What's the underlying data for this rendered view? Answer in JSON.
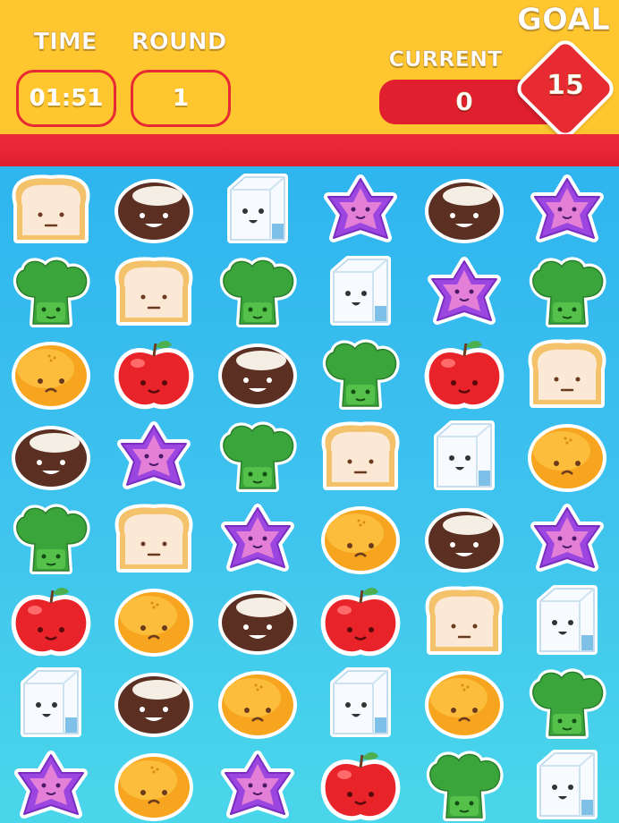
{
  "hud": {
    "time_label": "TIME",
    "time_value": "01:51",
    "round_label": "ROUND",
    "round_value": "1",
    "current_label": "CURRENT",
    "current_value": "0",
    "goal_label": "GOAL",
    "goal_value": "15",
    "progress": 0
  },
  "colors": {
    "header": "#ffc62f",
    "accent_red": "#e82a32",
    "board_top": "#2fb5ef",
    "board_bottom": "#4ad6ea"
  },
  "board": {
    "rows": 8,
    "cols": 6,
    "tiles": [
      [
        "bread",
        "coconut",
        "milk",
        "star",
        "coconut",
        "star"
      ],
      [
        "broccoli",
        "bread",
        "broccoli",
        "milk",
        "star",
        "broccoli"
      ],
      [
        "orange",
        "apple",
        "coconut",
        "broccoli",
        "apple",
        "bread"
      ],
      [
        "coconut",
        "star",
        "broccoli",
        "bread",
        "milk",
        "orange"
      ],
      [
        "broccoli",
        "bread",
        "star",
        "orange",
        "coconut",
        "star"
      ],
      [
        "apple",
        "orange",
        "coconut",
        "apple",
        "bread",
        "milk"
      ],
      [
        "milk",
        "coconut",
        "orange",
        "milk",
        "orange",
        "broccoli"
      ],
      [
        "star",
        "orange",
        "star",
        "apple",
        "broccoli",
        "milk"
      ]
    ]
  }
}
